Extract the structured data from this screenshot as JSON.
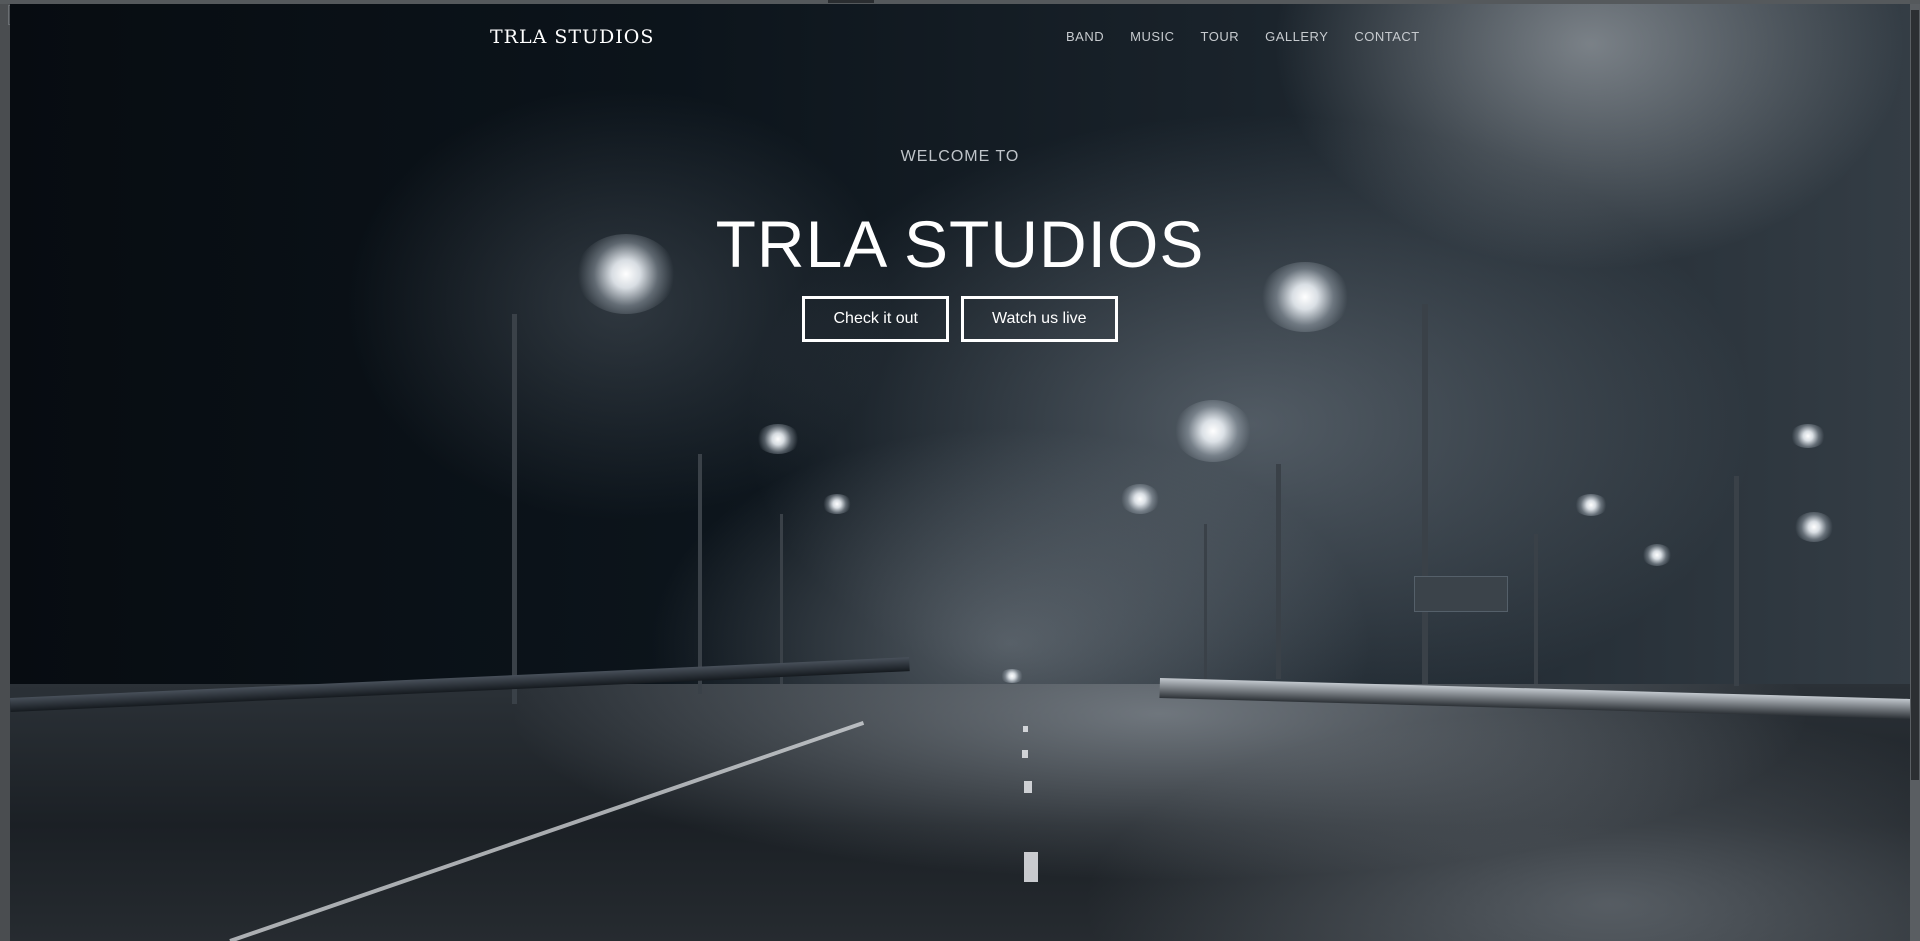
{
  "nav": {
    "brand": "TRLA STUDIOS",
    "links": [
      "BAND",
      "MUSIC",
      "TOUR",
      "GALLERY",
      "CONTACT"
    ]
  },
  "hero": {
    "subtitle": "WELCOME TO",
    "title": "TRLA STUDIOS",
    "buttons": [
      "Check it out",
      "Watch us live"
    ]
  },
  "icons": {
    "devtools_toggle": "collapse-arrow-icon",
    "background": "foggy-highway-streetlights-image"
  },
  "colors": {
    "text": "#ffffff",
    "nav_link": "#c7cbcf",
    "background_dark": "#0a1015"
  }
}
